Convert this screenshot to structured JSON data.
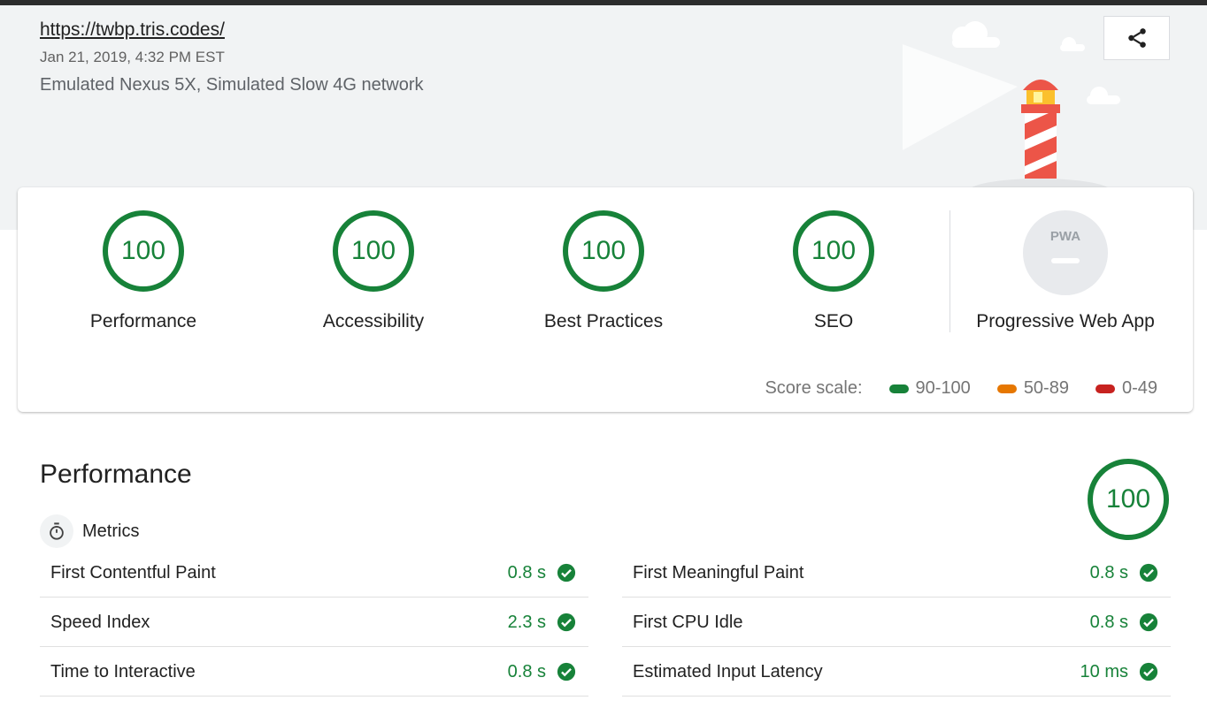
{
  "header": {
    "url": "https://twbp.tris.codes/",
    "date": "Jan 21, 2019, 4:32 PM EST",
    "environment": "Emulated Nexus 5X, Simulated Slow 4G network",
    "share_icon": "share-icon"
  },
  "summary": {
    "gauges": [
      {
        "score": "100",
        "label": "Performance"
      },
      {
        "score": "100",
        "label": "Accessibility"
      },
      {
        "score": "100",
        "label": "Best Practices"
      },
      {
        "score": "100",
        "label": "SEO"
      }
    ],
    "pwa": {
      "badge_text": "PWA",
      "label": "Progressive Web App"
    },
    "scale": {
      "label": "Score scale:",
      "ranges": [
        {
          "text": "90-100",
          "color": "#178239"
        },
        {
          "text": "50-89",
          "color": "#e67700"
        },
        {
          "text": "0-49",
          "color": "#c7221f"
        }
      ]
    }
  },
  "performance": {
    "title": "Performance",
    "score": "100",
    "metrics_title": "Metrics",
    "metrics": [
      {
        "name": "First Contentful Paint",
        "value": "0.8 s"
      },
      {
        "name": "First Meaningful Paint",
        "value": "0.8 s"
      },
      {
        "name": "Speed Index",
        "value": "2.3 s"
      },
      {
        "name": "First CPU Idle",
        "value": "0.8 s"
      },
      {
        "name": "Time to Interactive",
        "value": "0.8 s"
      },
      {
        "name": "Estimated Input Latency",
        "value": "10 ms"
      }
    ]
  },
  "colors": {
    "pass": "#178239",
    "average": "#e67700",
    "fail": "#c7221f"
  }
}
